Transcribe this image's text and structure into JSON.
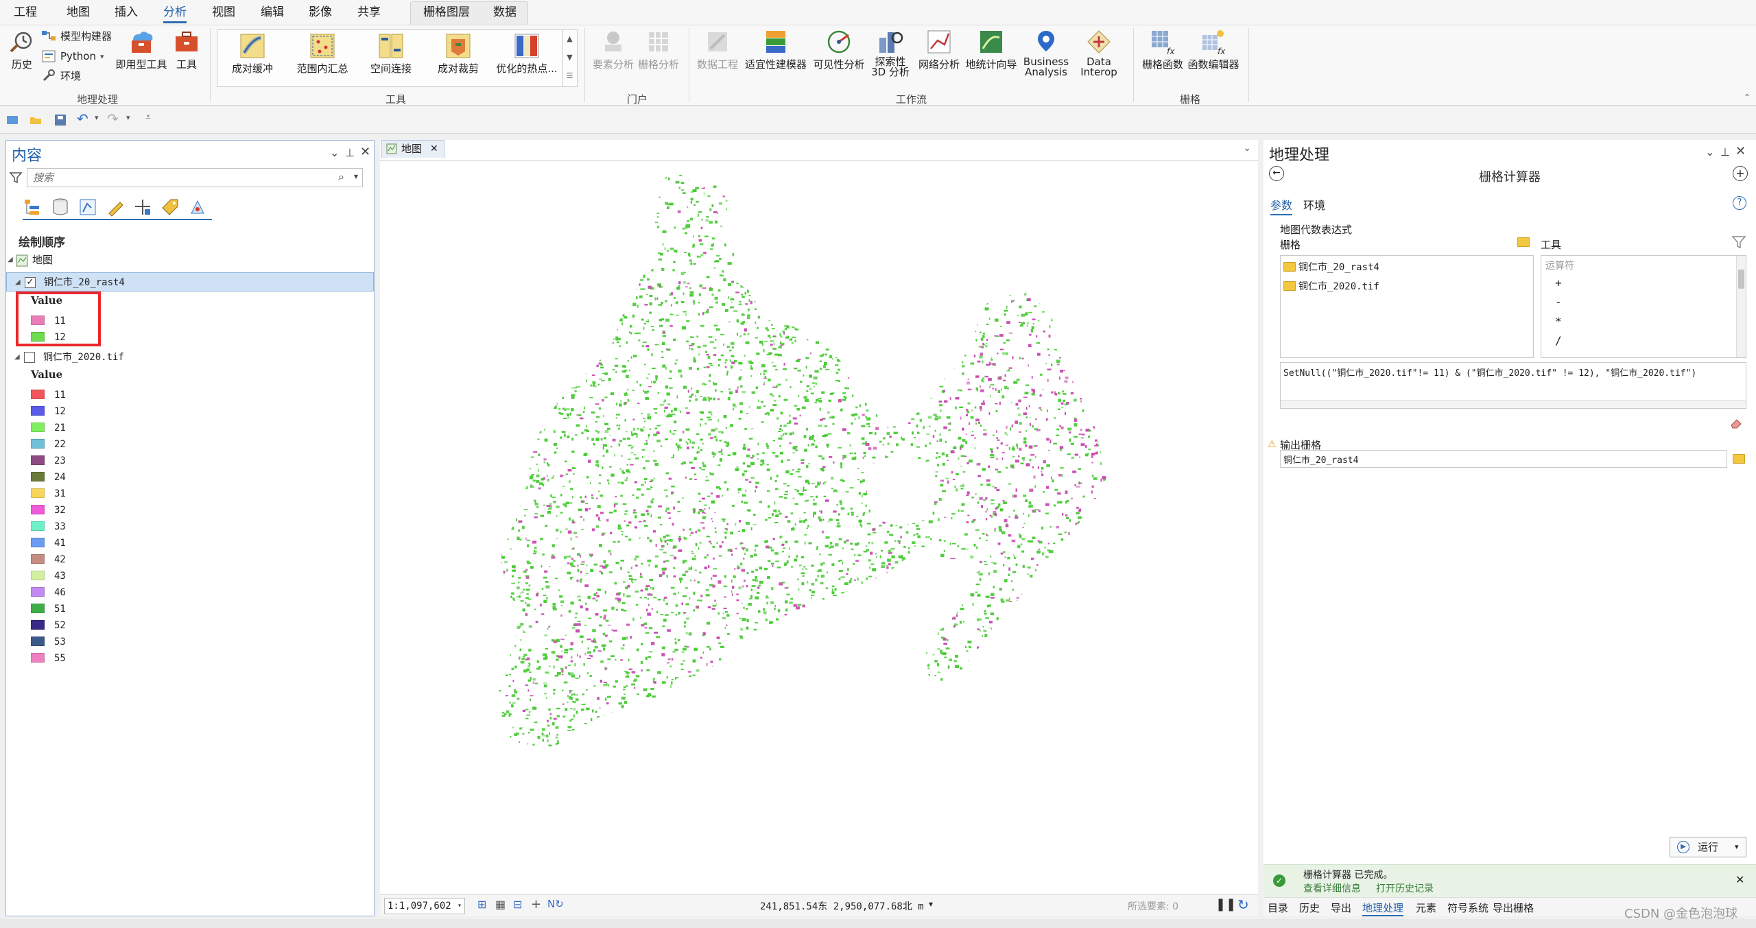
{
  "menu": {
    "tabs": [
      "工程",
      "地图",
      "插入",
      "分析",
      "视图",
      "编辑",
      "影像",
      "共享",
      "栅格图层",
      "数据"
    ],
    "active": "分析"
  },
  "ribbon": {
    "geoprocessing": {
      "history": "历史",
      "model_builder": "模型构建器",
      "python": "Python",
      "environments": "环境",
      "ready_tools": "即用型工具",
      "tools": "工具",
      "label": "地理处理"
    },
    "tools_gallery": {
      "items": [
        "成对缓冲",
        "范围内汇总",
        "空间连接",
        "成对裁剪",
        "优化的热点..."
      ],
      "label": "工具"
    },
    "portal": {
      "feature_analysis": "要素分析",
      "raster_analysis": "栅格分析",
      "label": "门户"
    },
    "workflows": {
      "data_engineering": "数据工程",
      "suitability_modeler": "适宜性建模器",
      "visibility_analysis": "可见性分析",
      "exploratory_3d_line1": "探索性",
      "exploratory_3d_line2": "3D 分析",
      "network_analysis": "网络分析",
      "geostatistical_wizard": "地统计向导",
      "business_analysis_line1": "Business",
      "business_analysis_line2": "Analysis",
      "data_interop_line1": "Data",
      "data_interop_line2": "Interop",
      "label": "工作流"
    },
    "raster": {
      "raster_functions": "栅格函数",
      "function_editor": "函数编辑器",
      "label": "栅格"
    }
  },
  "contents": {
    "title": "内容",
    "search_placeholder": "搜索",
    "drawing_order": "绘制顺序",
    "map_name": "地图",
    "layers": [
      {
        "name": "铜仁市_20_rast4",
        "checked": true,
        "field": "Value",
        "classes": [
          {
            "value": "11",
            "color": "#e87db8"
          },
          {
            "value": "12",
            "color": "#6ddc4e"
          }
        ]
      },
      {
        "name": "铜仁市_2020.tif",
        "checked": false,
        "field": "Value",
        "classes": [
          {
            "value": "11",
            "color": "#f0565a"
          },
          {
            "value": "12",
            "color": "#5b5bea"
          },
          {
            "value": "21",
            "color": "#7ef05e"
          },
          {
            "value": "22",
            "color": "#6fbfd6"
          },
          {
            "value": "23",
            "color": "#8e4a82"
          },
          {
            "value": "24",
            "color": "#6a7a3a"
          },
          {
            "value": "31",
            "color": "#f7d65a"
          },
          {
            "value": "32",
            "color": "#ee5ad8"
          },
          {
            "value": "33",
            "color": "#6ef0c8"
          },
          {
            "value": "41",
            "color": "#6c9cf0"
          },
          {
            "value": "42",
            "color": "#c48c82"
          },
          {
            "value": "43",
            "color": "#d2f0a0"
          },
          {
            "value": "46",
            "color": "#c28af0"
          },
          {
            "value": "51",
            "color": "#3fae4a"
          },
          {
            "value": "52",
            "color": "#3a2a86"
          },
          {
            "value": "53",
            "color": "#3c5a88"
          },
          {
            "value": "55",
            "color": "#ee80c0"
          }
        ]
      }
    ]
  },
  "map": {
    "tab_label": "地图",
    "scale": "1:1,097,602",
    "coordinates": "241,851.54东  2,950,077.68北 m",
    "selected_features": "所选要素: 0",
    "colors": {
      "pink": "#c84fb0",
      "green": "#4ccc38"
    }
  },
  "geoprocessing": {
    "title": "地理处理",
    "tool_title": "栅格计算器",
    "tab_params": "参数",
    "tab_env": "环境",
    "map_algebra_label": "地图代数表达式",
    "rasters_label": "栅格",
    "tools_label": "工具",
    "rasters": [
      "铜仁市_20_rast4",
      "铜仁市_2020.tif"
    ],
    "operators_header": "运算符",
    "operators": [
      "+",
      "-",
      "*",
      "/"
    ],
    "expression": "SetNull((\"铜仁市_2020.tif\"!= 11) & (\"铜仁市_2020.tif\" != 12), \"铜仁市_2020.tif\")",
    "output_label": "输出栅格",
    "output_value": "铜仁市_20_rast4",
    "run_label": "运行",
    "completion_message": "栅格计算器 已完成。",
    "view_details": "查看详细信息",
    "open_history": "打开历史记录",
    "bottom_tabs": [
      "目录",
      "历史",
      "导出",
      "地理处理",
      "元素",
      "符号系统",
      "导出栅格"
    ],
    "active_bottom_tab": "地理处理"
  },
  "watermark": "CSDN @金色泡泡球"
}
